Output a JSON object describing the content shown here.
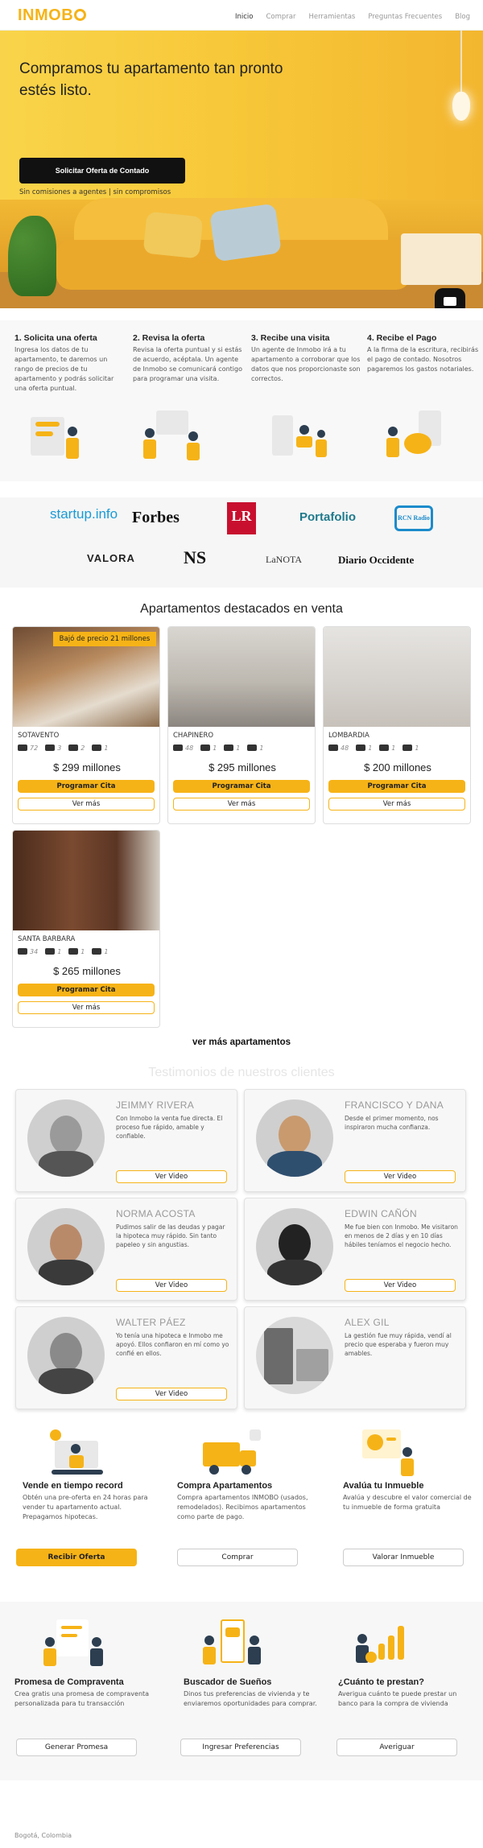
{
  "nav": {
    "logo": "INMOB",
    "items": [
      "Inicio",
      "Comprar",
      "Herramientas",
      "Preguntas Frecuentes",
      "Blog"
    ]
  },
  "hero": {
    "title": "Compramos tu apartamento tan pronto estés listo.",
    "cta": "Solicitar Oferta de Contado",
    "note": "Sin comisiones a agentes | sin compromisos"
  },
  "steps": [
    {
      "title": "1. Solicita una oferta",
      "text": "Ingresa los datos de tu apartamento, te daremos un rango de precios de tu apartamento y podrás solicitar una oferta puntual."
    },
    {
      "title": "2. Revisa la oferta",
      "text": "Revisa la oferta puntual y si estás de acuerdo, acéptala. Un agente de Inmobo se comunicará contigo para programar una visita."
    },
    {
      "title": "3. Recibe una visita",
      "text": "Un agente de Inmobo irá a tu apartamento a corroborar que los datos que nos proporcionaste son correctos."
    },
    {
      "title": "4. Recibe el Pago",
      "text": "A la firma de la escritura, recibirás el pago de contado. Nosotros pagaremos los gastos notariales."
    }
  ],
  "press": [
    "startup.info",
    "Forbes",
    "LR",
    "Portafolio",
    "RCN Radio",
    "VALORA",
    "NS",
    "LaNOTA",
    "Diario Occidente"
  ],
  "featured": {
    "title": "Apartamentos destacados en venta",
    "cards": [
      {
        "badge": "Bajó de precio 21 millones",
        "location": "SOTAVENTO",
        "area": "72",
        "beds": "3",
        "baths": "2",
        "parking": "1",
        "price": "$ 299 millones",
        "btn_primary": "Programar Cita",
        "btn_secondary": "Ver más"
      },
      {
        "badge": "",
        "location": "CHAPINERO",
        "area": "48",
        "beds": "1",
        "baths": "1",
        "parking": "1",
        "price": "$ 295 millones",
        "btn_primary": "Programar Cita",
        "btn_secondary": "Ver más"
      },
      {
        "badge": "",
        "location": "LOMBARDIA",
        "area": "48",
        "beds": "1",
        "baths": "1",
        "parking": "1",
        "price": "$ 200 millones",
        "btn_primary": "Programar Cita",
        "btn_secondary": "Ver más"
      },
      {
        "badge": "",
        "location": "SANTA BARBARA",
        "area": "34",
        "beds": "1",
        "baths": "1",
        "parking": "1",
        "price": "$ 265 millones",
        "btn_primary": "Programar Cita",
        "btn_secondary": "Ver más"
      }
    ],
    "more_link": "ver más apartamentos"
  },
  "testimonials": {
    "title": "Testimonios de nuestros clientes",
    "items": [
      {
        "name": "JEIMMY RIVERA",
        "quote": "Con Inmobo la venta fue directa. El proceso fue rápido, amable y confiable.",
        "button": "Ver Video"
      },
      {
        "name": "FRANCISCO Y DANA",
        "quote": "Desde el primer momento, nos inspiraron mucha confianza.",
        "button": "Ver Video"
      },
      {
        "name": "NORMA ACOSTA",
        "quote": "Pudimos salir de las deudas y pagar la hipoteca muy rápido. Sin tanto papeleo y sin angustias.",
        "button": "Ver Video"
      },
      {
        "name": "EDWIN CAÑÓN",
        "quote": "Me fue bien con Inmobo. Me visitaron en menos de 2 días y en 10 días hábiles teníamos el negocio hecho.",
        "button": "Ver Video"
      },
      {
        "name": "WALTER PÁEZ",
        "quote": "Yo tenía una hipoteca e Inmobo me apoyó. Ellos confiaron en mí como yo confié en ellos.",
        "button": "Ver Video"
      },
      {
        "name": "ALEX GIL",
        "quote": "La gestión fue muy rápida, vendí al precio que esperaba y fueron muy amables.",
        "button": ""
      }
    ]
  },
  "services": [
    {
      "title": "Vende en tiempo record",
      "text": "Obtén una pre-oferta en 24 horas para vender tu apartamento actual. Prepagamos hipotecas.",
      "button": "Recibir Oferta"
    },
    {
      "title": "Compra Apartamentos",
      "text": "Compra apartamentos INMOBO (usados, remodelados). Recibimos apartamentos como parte de pago.",
      "button": "Comprar"
    },
    {
      "title": "Avalúa tu Inmueble",
      "text": "Avalúa y descubre el valor comercial de tu inmueble de forma gratuita",
      "button": "Valorar Inmueble"
    }
  ],
  "tools": [
    {
      "title": "Promesa de Compraventa",
      "text": "Crea gratis una promesa de compraventa personalizada para tu transacción",
      "button": "Generar Promesa"
    },
    {
      "title": "Buscador de Sueños",
      "text": "Dinos tus preferencias de vivienda y te enviaremos oportunidades para comprar.",
      "button": "Ingresar Preferencias"
    },
    {
      "title": "¿Cuánto te prestan?",
      "text": "Averigua cuánto te puede prestar un banco para la compra de vivienda",
      "button": "Averiguar"
    }
  ],
  "footer": {
    "location": "Bogotá, Colombia"
  },
  "colors": {
    "accent": "#f6b317",
    "dark": "#111111"
  }
}
